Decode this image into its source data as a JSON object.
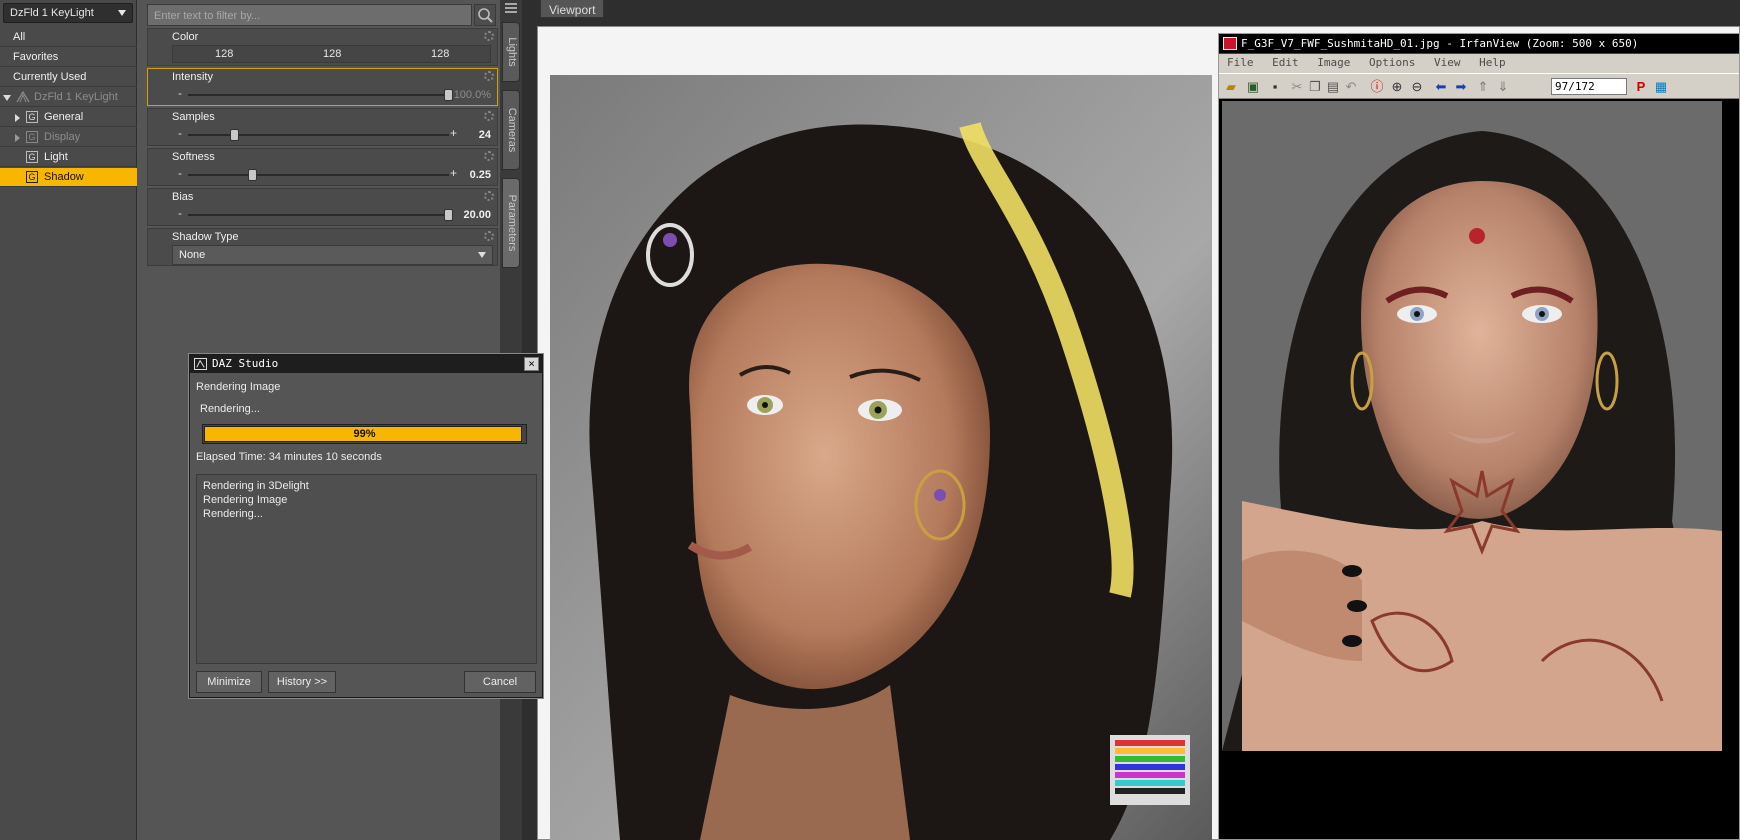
{
  "scene": {
    "node_select": "DzFld 1 KeyLight",
    "tree": [
      {
        "label": "All",
        "kind": "filter"
      },
      {
        "label": "Favorites",
        "kind": "filter"
      },
      {
        "label": "Currently Used",
        "kind": "filter"
      },
      {
        "label": "DzFld 1 KeyLight",
        "kind": "node",
        "state": "dim"
      },
      {
        "label": "General",
        "kind": "group"
      },
      {
        "label": "Display",
        "kind": "group",
        "state": "dim"
      },
      {
        "label": "Light",
        "kind": "group"
      },
      {
        "label": "Shadow",
        "kind": "group",
        "state": "selected"
      }
    ],
    "group_glyph": "G"
  },
  "params": {
    "filter_placeholder": "Enter text to filter by...",
    "color": {
      "label": "Color",
      "r": "128",
      "g": "128",
      "b": "128"
    },
    "intensity": {
      "label": "Intensity",
      "value": "100.0%",
      "level": 1.0
    },
    "samples": {
      "label": "Samples",
      "value": "24",
      "level": 0.18
    },
    "softness": {
      "label": "Softness",
      "value": "0.25",
      "level": 0.25
    },
    "bias": {
      "label": "Bias",
      "value": "20.00",
      "level": 1.0
    },
    "shadow_type": {
      "label": "Shadow Type",
      "value": "None"
    },
    "minus": "-",
    "plus": "+"
  },
  "side_tabs": [
    "Lights",
    "Cameras",
    "Parameters"
  ],
  "viewport": {
    "tab": "Viewport"
  },
  "dialog": {
    "title": "DAZ Studio",
    "heading": "Rendering Image",
    "status": "Rendering...",
    "progress_label": "99%",
    "progress": 0.99,
    "elapsed": "Elapsed Time:  34 minutes 10 seconds",
    "log": [
      "Rendering in 3Delight",
      "Rendering Image",
      "Rendering..."
    ],
    "minimize": "Minimize",
    "history": "History >>",
    "cancel": "Cancel",
    "close": "×"
  },
  "irfanview": {
    "title": "F_G3F_V7_FWF_SushmitaHD_01.jpg - IrfanView (Zoom: 500 x 650)",
    "menu": [
      "File",
      "Edit",
      "Image",
      "Options",
      "View",
      "Help"
    ],
    "page_field": "97/172",
    "p_glyph": "P"
  },
  "colors": {
    "accent": "#f7b700",
    "panel": "#4a4a4a",
    "viewport_bg": "#f4f4f4"
  }
}
